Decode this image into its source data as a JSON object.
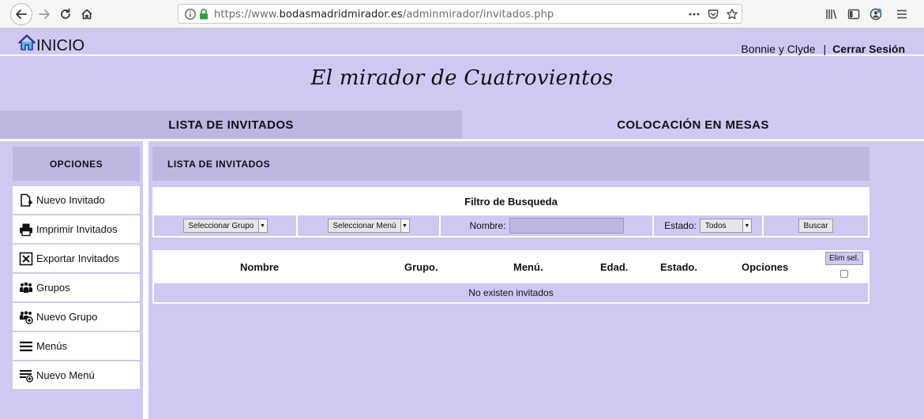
{
  "browser": {
    "url_prefix": "https://www.",
    "url_domain": "bodasmadridmirador.es",
    "url_path": "/adminmirador/invitados.php",
    "icons": [
      "back-icon",
      "forward-icon",
      "reload-icon",
      "home-icon",
      "info-icon",
      "lock-icon",
      "more-icon",
      "pocket-icon",
      "bookmark-star-icon",
      "library-icon",
      "sidebar-icon",
      "account-icon",
      "menu-icon"
    ]
  },
  "topbar": {
    "home_label": "INICIO",
    "user_name": "Bonnie y Clyde",
    "separator": "|",
    "logout_label": "Cerrar Sesión"
  },
  "site_title": "El mirador de Cuatrovientos",
  "main_tabs": [
    {
      "label": "LISTA DE INVITADOS",
      "active": true
    },
    {
      "label": "COLOCACIÓN EN MESAS",
      "active": false
    }
  ],
  "sidebar": {
    "heading": "OPCIONES",
    "items": [
      {
        "label": "Nuevo Invitado",
        "icon": "add-document-icon"
      },
      {
        "label": "Imprimir Invitados",
        "icon": "printer-icon"
      },
      {
        "label": "Exportar Invitados",
        "icon": "excel-export-icon"
      },
      {
        "label": "Grupos",
        "icon": "group-icon"
      },
      {
        "label": "Nuevo Grupo",
        "icon": "add-group-icon"
      },
      {
        "label": "Menús",
        "icon": "list-icon"
      },
      {
        "label": "Nuevo Menú",
        "icon": "add-list-icon"
      }
    ]
  },
  "content": {
    "heading": "LISTA DE INVITADOS",
    "filter": {
      "title": "Filtro de Busqueda",
      "group_select": "Seleccionar Grupo",
      "menu_select": "Seleccionar Menú",
      "name_label": "Nombre:",
      "name_value": "",
      "state_label": "Estado:",
      "state_select": "Todos",
      "search_button": "Buscar"
    },
    "table": {
      "columns": [
        "Nombre",
        "Grupo.",
        "Menú.",
        "Edad.",
        "Estado.",
        "Opciones"
      ],
      "delete_selected": "Elim sel.",
      "empty_message": "No existen invitados"
    }
  },
  "colors": {
    "background": "#cfc8f3",
    "panel_dark": "#bdb7e2",
    "white": "#ffffff",
    "home_icon_blue": "#3a7bd5",
    "lock_green": "#2ea043"
  }
}
